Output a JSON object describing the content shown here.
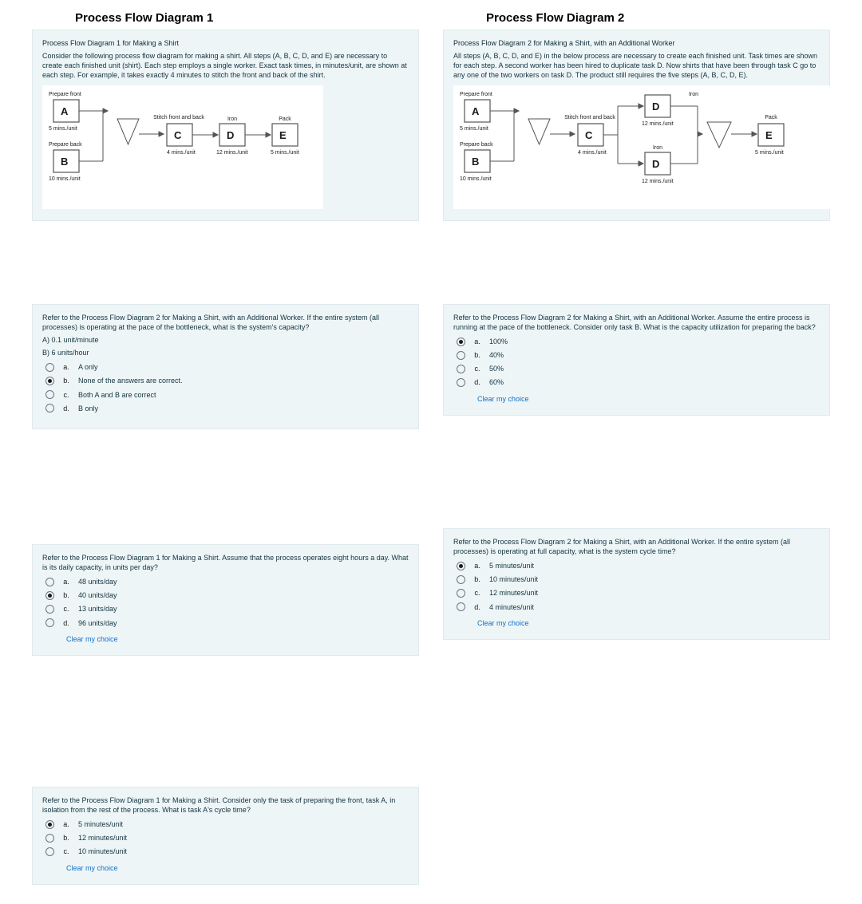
{
  "headings": {
    "d1": "Process Flow Diagram 1",
    "d2": "Process Flow Diagram 2"
  },
  "diagram1": {
    "title": "Process Flow Diagram 1 for Making a Shirt",
    "desc": "Consider the following process flow diagram for making a shirt. All steps (A, B, C, D, and E) are necessary to create each finished unit (shirt). Each step employs a single worker. Exact task times, in minutes/unit, are shown at each step. For example, it takes exactly 4 minutes to stitch the front and back of the shirt.",
    "labels": {
      "prep_front": "Prepare front",
      "prep_back": "Prepare back",
      "stitch": "Stitch front and back",
      "iron": "Iron",
      "pack": "Pack"
    },
    "nodes": {
      "A": "A",
      "B": "B",
      "C": "C",
      "D": "D",
      "E": "E"
    },
    "times": {
      "A": "5 mins./unit",
      "B": "10 mins./unit",
      "C": "4 mins./unit",
      "D": "12 mins./unit",
      "E": "5 mins./unit"
    }
  },
  "diagram2": {
    "title": "Process Flow Diagram 2 for Making a Shirt, with an Additional Worker",
    "desc": "All steps (A, B, C, D, and E) in the below process are necessary to create each finished unit. Task times are shown for each step. A second worker has been hired to duplicate task D. Now shirts that have been through task C go to any one of the two workers on task D. The product still requires the five steps (A, B, C, D, E).",
    "labels": {
      "prep_front": "Prepare front",
      "prep_back": "Prepare back",
      "stitch": "Stitch front and back",
      "iron": "Iron",
      "pack": "Pack"
    },
    "nodes": {
      "A": "A",
      "B": "B",
      "C": "C",
      "D1": "D",
      "D2": "D",
      "E": "E"
    },
    "times": {
      "A": "5 mins./unit",
      "B": "10 mins./unit",
      "C": "4 mins./unit",
      "D1": "12 mins./unit",
      "D2": "12 mins./unit",
      "E": "5 mins./unit"
    }
  },
  "q1": {
    "text": "Refer to the Process Flow Diagram 2 for Making a Shirt, with an Additional Worker. If the entire system (all processes) is operating at the pace of the bottleneck, what is the system's capacity?",
    "lineA": "A) 0.1 unit/minute",
    "lineB": "B) 6 units/hour",
    "options": [
      {
        "key": "a.",
        "text": "A only",
        "selected": false
      },
      {
        "key": "b.",
        "text": "None of the answers are correct.",
        "selected": true
      },
      {
        "key": "c.",
        "text": "Both A and B are correct",
        "selected": false
      },
      {
        "key": "d.",
        "text": "B only",
        "selected": false
      }
    ]
  },
  "q2": {
    "text": "Refer to the Process Flow Diagram 2 for Making a Shirt, with an Additional Worker. Assume the entire process is running at the pace of the bottleneck. Consider only task B. What is the capacity utilization for preparing the back?",
    "options": [
      {
        "key": "a.",
        "text": "100%",
        "selected": true
      },
      {
        "key": "b.",
        "text": "40%",
        "selected": false
      },
      {
        "key": "c.",
        "text": "50%",
        "selected": false
      },
      {
        "key": "d.",
        "text": "60%",
        "selected": false
      }
    ],
    "clear": "Clear my choice"
  },
  "q3": {
    "text": "Refer to the Process Flow Diagram 1 for Making a Shirt. Assume that the process operates eight hours a day. What is its daily capacity, in units per day?",
    "options": [
      {
        "key": "a.",
        "text": "48 units/day",
        "selected": false
      },
      {
        "key": "b.",
        "text": "40 units/day",
        "selected": true
      },
      {
        "key": "c.",
        "text": "13 units/day",
        "selected": false
      },
      {
        "key": "d.",
        "text": "96 units/day",
        "selected": false
      }
    ],
    "clear": "Clear my choice"
  },
  "q4": {
    "text": "Refer to the Process Flow Diagram 2 for Making a Shirt, with an Additional Worker. If the entire system (all processes) is operating at full capacity, what is the system cycle time?",
    "options": [
      {
        "key": "a.",
        "text": "5 minutes/unit",
        "selected": true
      },
      {
        "key": "b.",
        "text": "10 minutes/unit",
        "selected": false
      },
      {
        "key": "c.",
        "text": "12 minutes/unit",
        "selected": false
      },
      {
        "key": "d.",
        "text": "4 minutes/unit",
        "selected": false
      }
    ],
    "clear": "Clear my choice"
  },
  "q5": {
    "text": "Refer to the Process Flow Diagram 1 for Making a Shirt. Consider only the task of preparing the front, task A, in isolation from the rest of the process. What is task A's cycle time?",
    "options": [
      {
        "key": "a.",
        "text": "5 minutes/unit",
        "selected": true
      },
      {
        "key": "b.",
        "text": "12 minutes/unit",
        "selected": false
      },
      {
        "key": "c.",
        "text": "10 minutes/unit",
        "selected": false
      }
    ],
    "clear": "Clear my choice"
  }
}
